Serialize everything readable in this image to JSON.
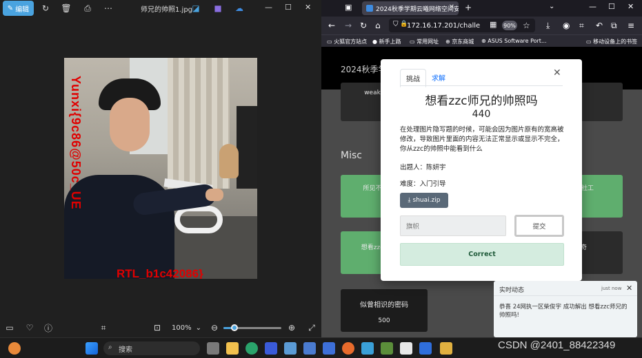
{
  "viewer": {
    "edit_label": "编辑",
    "file_title": "师兄的帅照1.jpg",
    "zoom": "100%",
    "zoom_fraction": 0.14,
    "watermark_vertical": "Yunxi{9c86@50c_UE",
    "watermark_bottom": "RTL_b1c42086}"
  },
  "browser": {
    "tab_title": "2024秋季学期云曦网络空间安",
    "url": "172.16.17.201/challe",
    "zoom": "90%",
    "bookmarks": [
      "火狐官方站点",
      "新手上路",
      "常用网址",
      "京东商城",
      "ASUS Software Port...",
      "移动设备上的书签"
    ],
    "site_title": "2024秋季学",
    "misc_label": "Misc",
    "cards": {
      "weak_label": "weak",
      "card_a": "所见不",
      "card_b": "社工",
      "card_c": "想看zzc",
      "card_d": "奇",
      "card_e_title": "似曾相识的密码",
      "card_e_points": "500"
    },
    "modal": {
      "tab_challenge": "挑战",
      "tab_solves": "求解",
      "title": "想看zzc师兄的帅照吗",
      "points": "440",
      "description": "在处理图片隐写题的时候，可能会因为图片原有的宽高被修改，导致图片里面的内容无法正常显示或显示不完全，你从zzc的帅照中能看到什么",
      "author": "出题人：陈妍宇",
      "difficulty": "难度：入门引导",
      "file": "shuai.zip",
      "flag_placeholder": "旗帜",
      "submit": "提交",
      "result": "Correct"
    },
    "toast": {
      "title": "实时动态",
      "time": "just now",
      "body": "恭喜 24网执一区柴俊宇 成功解出 想看zzc师兄的帅照吗!"
    }
  },
  "taskbar": {
    "search_label": "搜索",
    "watermark": "CSDN @2401_88422349"
  },
  "colors": {
    "accent": "#4aa3df",
    "correct_bg": "#d4ecdf",
    "watermark_red": "#e00000"
  }
}
